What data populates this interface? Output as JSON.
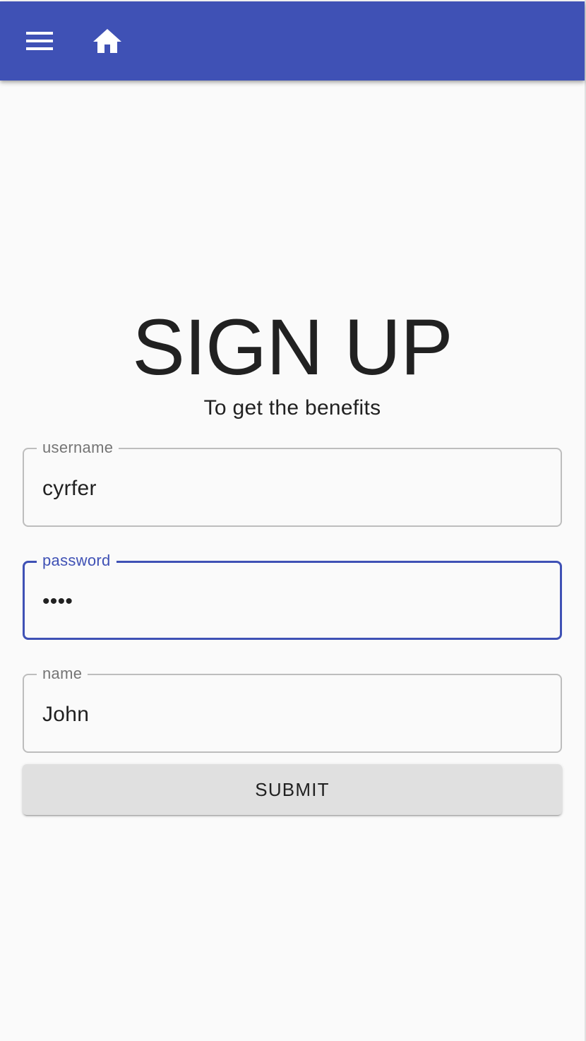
{
  "app_bar": {
    "menu_icon": "hamburger-menu-icon",
    "home_icon": "home-icon",
    "color": "#3f51b5"
  },
  "page": {
    "title": "SIGN UP",
    "subtitle": "To get the benefits"
  },
  "form": {
    "username": {
      "label": "username",
      "value": "cyrfer"
    },
    "password": {
      "label": "password",
      "value": "••••",
      "focused": true
    },
    "name": {
      "label": "name",
      "value": "John"
    },
    "submit_label": "SUBMIT"
  },
  "colors": {
    "accent": "#3f51b5",
    "background": "#fafafa",
    "button": "#e0e0e0"
  }
}
